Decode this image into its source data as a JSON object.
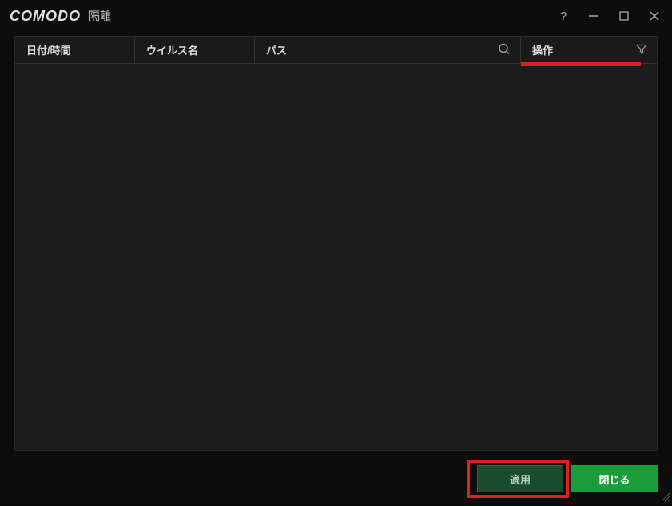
{
  "titlebar": {
    "logo": "COMODO",
    "title": "隔離"
  },
  "table": {
    "headers": {
      "datetime": "日付/時間",
      "virus_name": "ウイルス名",
      "path": "パス",
      "action": "操作"
    },
    "rows": []
  },
  "footer": {
    "apply_label": "適用",
    "close_label": "閉じる"
  }
}
